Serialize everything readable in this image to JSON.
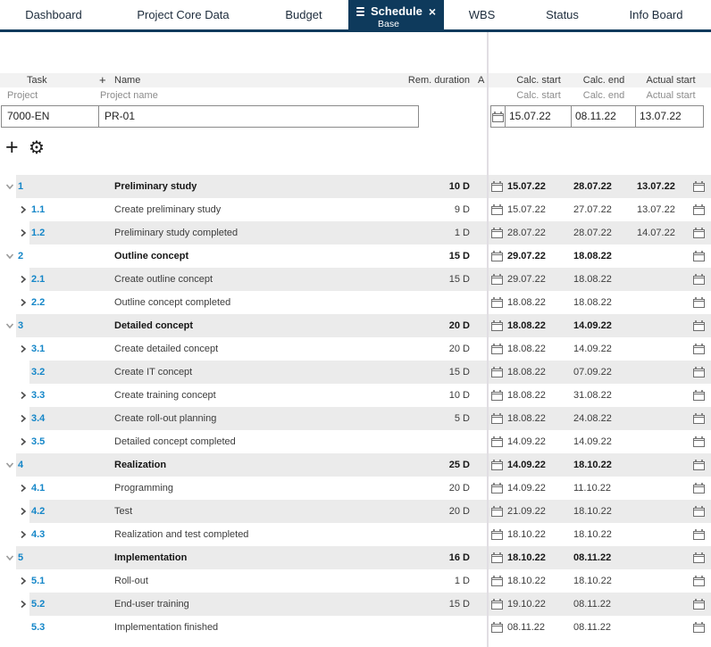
{
  "tabs": [
    {
      "label": "Dashboard"
    },
    {
      "label": "Project Core Data"
    },
    {
      "label": "Budget"
    },
    {
      "label": "Schedule",
      "sublabel": "Base",
      "active": true
    },
    {
      "label": "WBS"
    },
    {
      "label": "Status"
    },
    {
      "label": "Info Board"
    }
  ],
  "columns": {
    "task": "Task",
    "add": "+",
    "name": "Name",
    "rem_duration": "Rem. duration",
    "truncated": "A",
    "calc_start": "Calc. start",
    "calc_end": "Calc. end",
    "actual_start": "Actual start"
  },
  "subcolumns": {
    "project": "Project",
    "project_name": "Project name",
    "calc_start": "Calc. start",
    "calc_end": "Calc. end",
    "actual_start": "Actual start"
  },
  "project": {
    "id": "7000-EN",
    "name": "PR-01",
    "calc_start": "15.07.22",
    "calc_end": "08.11.22",
    "actual_start": "13.07.22"
  },
  "toolbar": {
    "add": "+",
    "settings": "⚙"
  },
  "colors": {
    "navy": "#0e3a5c",
    "number_blue": "#1486c8",
    "stripe": "#ebebeb"
  },
  "tasks": [
    {
      "number": "1",
      "name": "Preliminary study",
      "duration": "10 D",
      "calc_start": "15.07.22",
      "calc_end": "28.07.22",
      "actual_start": "13.07.22",
      "level": 1,
      "chevron": "down",
      "bold": true
    },
    {
      "number": "1.1",
      "name": "Create preliminary study",
      "duration": "9 D",
      "calc_start": "15.07.22",
      "calc_end": "27.07.22",
      "actual_start": "13.07.22",
      "level": 2,
      "chevron": "right",
      "bold": false
    },
    {
      "number": "1.2",
      "name": "Preliminary study completed",
      "duration": "1 D",
      "calc_start": "28.07.22",
      "calc_end": "28.07.22",
      "actual_start": "14.07.22",
      "level": 2,
      "chevron": "right",
      "bold": false
    },
    {
      "number": "2",
      "name": "Outline concept",
      "duration": "15 D",
      "calc_start": "29.07.22",
      "calc_end": "18.08.22",
      "actual_start": "",
      "level": 1,
      "chevron": "down",
      "bold": true
    },
    {
      "number": "2.1",
      "name": "Create outline concept",
      "duration": "15 D",
      "calc_start": "29.07.22",
      "calc_end": "18.08.22",
      "actual_start": "",
      "level": 2,
      "chevron": "right",
      "bold": false
    },
    {
      "number": "2.2",
      "name": "Outline concept completed",
      "duration": "",
      "calc_start": "18.08.22",
      "calc_end": "18.08.22",
      "actual_start": "",
      "level": 2,
      "chevron": "right",
      "bold": false
    },
    {
      "number": "3",
      "name": "Detailed concept",
      "duration": "20 D",
      "calc_start": "18.08.22",
      "calc_end": "14.09.22",
      "actual_start": "",
      "level": 1,
      "chevron": "down",
      "bold": true
    },
    {
      "number": "3.1",
      "name": "Create detailed concept",
      "duration": "20 D",
      "calc_start": "18.08.22",
      "calc_end": "14.09.22",
      "actual_start": "",
      "level": 2,
      "chevron": "right",
      "bold": false
    },
    {
      "number": "3.2",
      "name": "Create IT concept",
      "duration": "15 D",
      "calc_start": "18.08.22",
      "calc_end": "07.09.22",
      "actual_start": "",
      "level": 2,
      "chevron": "none",
      "bold": false
    },
    {
      "number": "3.3",
      "name": "Create training concept",
      "duration": "10 D",
      "calc_start": "18.08.22",
      "calc_end": "31.08.22",
      "actual_start": "",
      "level": 2,
      "chevron": "right",
      "bold": false
    },
    {
      "number": "3.4",
      "name": "Create roll-out planning",
      "duration": "5 D",
      "calc_start": "18.08.22",
      "calc_end": "24.08.22",
      "actual_start": "",
      "level": 2,
      "chevron": "right",
      "bold": false
    },
    {
      "number": "3.5",
      "name": "Detailed concept completed",
      "duration": "",
      "calc_start": "14.09.22",
      "calc_end": "14.09.22",
      "actual_start": "",
      "level": 2,
      "chevron": "right",
      "bold": false
    },
    {
      "number": "4",
      "name": "Realization",
      "duration": "25 D",
      "calc_start": "14.09.22",
      "calc_end": "18.10.22",
      "actual_start": "",
      "level": 1,
      "chevron": "down",
      "bold": true
    },
    {
      "number": "4.1",
      "name": "Programming",
      "duration": "20 D",
      "calc_start": "14.09.22",
      "calc_end": "11.10.22",
      "actual_start": "",
      "level": 2,
      "chevron": "right",
      "bold": false
    },
    {
      "number": "4.2",
      "name": "Test",
      "duration": "20 D",
      "calc_start": "21.09.22",
      "calc_end": "18.10.22",
      "actual_start": "",
      "level": 2,
      "chevron": "right",
      "bold": false
    },
    {
      "number": "4.3",
      "name": "Realization and test completed",
      "duration": "",
      "calc_start": "18.10.22",
      "calc_end": "18.10.22",
      "actual_start": "",
      "level": 2,
      "chevron": "right",
      "bold": false
    },
    {
      "number": "5",
      "name": "Implementation",
      "duration": "16 D",
      "calc_start": "18.10.22",
      "calc_end": "08.11.22",
      "actual_start": "",
      "level": 1,
      "chevron": "down",
      "bold": true
    },
    {
      "number": "5.1",
      "name": "Roll-out",
      "duration": "1 D",
      "calc_start": "18.10.22",
      "calc_end": "18.10.22",
      "actual_start": "",
      "level": 2,
      "chevron": "right",
      "bold": false
    },
    {
      "number": "5.2",
      "name": "End-user training",
      "duration": "15 D",
      "calc_start": "19.10.22",
      "calc_end": "08.11.22",
      "actual_start": "",
      "level": 2,
      "chevron": "right",
      "bold": false
    },
    {
      "number": "5.3",
      "name": "Implementation finished",
      "duration": "",
      "calc_start": "08.11.22",
      "calc_end": "08.11.22",
      "actual_start": "",
      "level": 2,
      "chevron": "none",
      "bold": false
    }
  ]
}
